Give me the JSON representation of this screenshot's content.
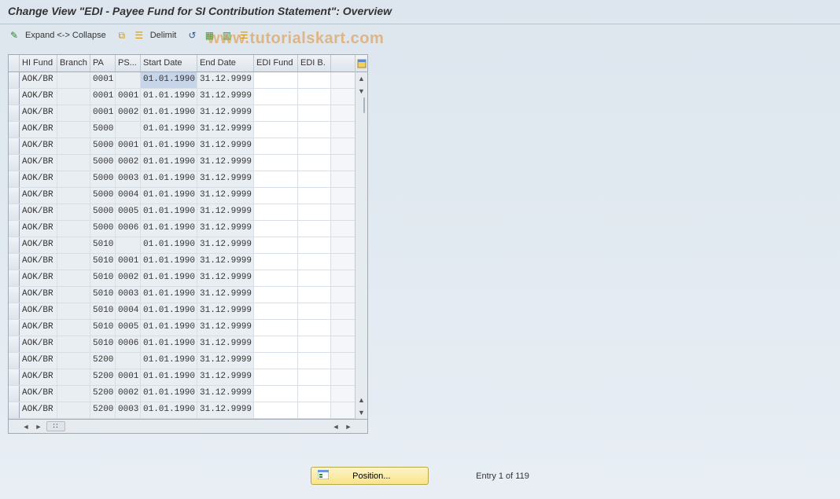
{
  "title": "Change View \"EDI - Payee Fund for SI Contribution Statement\": Overview",
  "toolbar": {
    "expand_collapse": "Expand <-> Collapse",
    "delimit": "Delimit"
  },
  "watermark": "www.tutorialskart.com",
  "columns": {
    "hifund": "HI Fund",
    "branch": "Branch",
    "pa": "PA",
    "ps": "PS...",
    "start": "Start Date",
    "end": "End Date",
    "edifund": "EDI Fund",
    "edib": "EDI B."
  },
  "rows": [
    {
      "hifund": "AOK/BR",
      "branch": "",
      "pa": "0001",
      "ps": "",
      "start": "01.01.1990",
      "end": "31.12.9999",
      "edifund": "",
      "edib": "",
      "sel": true
    },
    {
      "hifund": "AOK/BR",
      "branch": "",
      "pa": "0001",
      "ps": "0001",
      "start": "01.01.1990",
      "end": "31.12.9999",
      "edifund": "",
      "edib": ""
    },
    {
      "hifund": "AOK/BR",
      "branch": "",
      "pa": "0001",
      "ps": "0002",
      "start": "01.01.1990",
      "end": "31.12.9999",
      "edifund": "",
      "edib": ""
    },
    {
      "hifund": "AOK/BR",
      "branch": "",
      "pa": "5000",
      "ps": "",
      "start": "01.01.1990",
      "end": "31.12.9999",
      "edifund": "",
      "edib": ""
    },
    {
      "hifund": "AOK/BR",
      "branch": "",
      "pa": "5000",
      "ps": "0001",
      "start": "01.01.1990",
      "end": "31.12.9999",
      "edifund": "",
      "edib": ""
    },
    {
      "hifund": "AOK/BR",
      "branch": "",
      "pa": "5000",
      "ps": "0002",
      "start": "01.01.1990",
      "end": "31.12.9999",
      "edifund": "",
      "edib": ""
    },
    {
      "hifund": "AOK/BR",
      "branch": "",
      "pa": "5000",
      "ps": "0003",
      "start": "01.01.1990",
      "end": "31.12.9999",
      "edifund": "",
      "edib": ""
    },
    {
      "hifund": "AOK/BR",
      "branch": "",
      "pa": "5000",
      "ps": "0004",
      "start": "01.01.1990",
      "end": "31.12.9999",
      "edifund": "",
      "edib": ""
    },
    {
      "hifund": "AOK/BR",
      "branch": "",
      "pa": "5000",
      "ps": "0005",
      "start": "01.01.1990",
      "end": "31.12.9999",
      "edifund": "",
      "edib": ""
    },
    {
      "hifund": "AOK/BR",
      "branch": "",
      "pa": "5000",
      "ps": "0006",
      "start": "01.01.1990",
      "end": "31.12.9999",
      "edifund": "",
      "edib": ""
    },
    {
      "hifund": "AOK/BR",
      "branch": "",
      "pa": "5010",
      "ps": "",
      "start": "01.01.1990",
      "end": "31.12.9999",
      "edifund": "",
      "edib": ""
    },
    {
      "hifund": "AOK/BR",
      "branch": "",
      "pa": "5010",
      "ps": "0001",
      "start": "01.01.1990",
      "end": "31.12.9999",
      "edifund": "",
      "edib": ""
    },
    {
      "hifund": "AOK/BR",
      "branch": "",
      "pa": "5010",
      "ps": "0002",
      "start": "01.01.1990",
      "end": "31.12.9999",
      "edifund": "",
      "edib": ""
    },
    {
      "hifund": "AOK/BR",
      "branch": "",
      "pa": "5010",
      "ps": "0003",
      "start": "01.01.1990",
      "end": "31.12.9999",
      "edifund": "",
      "edib": ""
    },
    {
      "hifund": "AOK/BR",
      "branch": "",
      "pa": "5010",
      "ps": "0004",
      "start": "01.01.1990",
      "end": "31.12.9999",
      "edifund": "",
      "edib": ""
    },
    {
      "hifund": "AOK/BR",
      "branch": "",
      "pa": "5010",
      "ps": "0005",
      "start": "01.01.1990",
      "end": "31.12.9999",
      "edifund": "",
      "edib": ""
    },
    {
      "hifund": "AOK/BR",
      "branch": "",
      "pa": "5010",
      "ps": "0006",
      "start": "01.01.1990",
      "end": "31.12.9999",
      "edifund": "",
      "edib": ""
    },
    {
      "hifund": "AOK/BR",
      "branch": "",
      "pa": "5200",
      "ps": "",
      "start": "01.01.1990",
      "end": "31.12.9999",
      "edifund": "",
      "edib": ""
    },
    {
      "hifund": "AOK/BR",
      "branch": "",
      "pa": "5200",
      "ps": "0001",
      "start": "01.01.1990",
      "end": "31.12.9999",
      "edifund": "",
      "edib": ""
    },
    {
      "hifund": "AOK/BR",
      "branch": "",
      "pa": "5200",
      "ps": "0002",
      "start": "01.01.1990",
      "end": "31.12.9999",
      "edifund": "",
      "edib": ""
    },
    {
      "hifund": "AOK/BR",
      "branch": "",
      "pa": "5200",
      "ps": "0003",
      "start": "01.01.1990",
      "end": "31.12.9999",
      "edifund": "",
      "edib": ""
    }
  ],
  "footer": {
    "position_label": "Position...",
    "entry_text": "Entry 1 of 119"
  }
}
